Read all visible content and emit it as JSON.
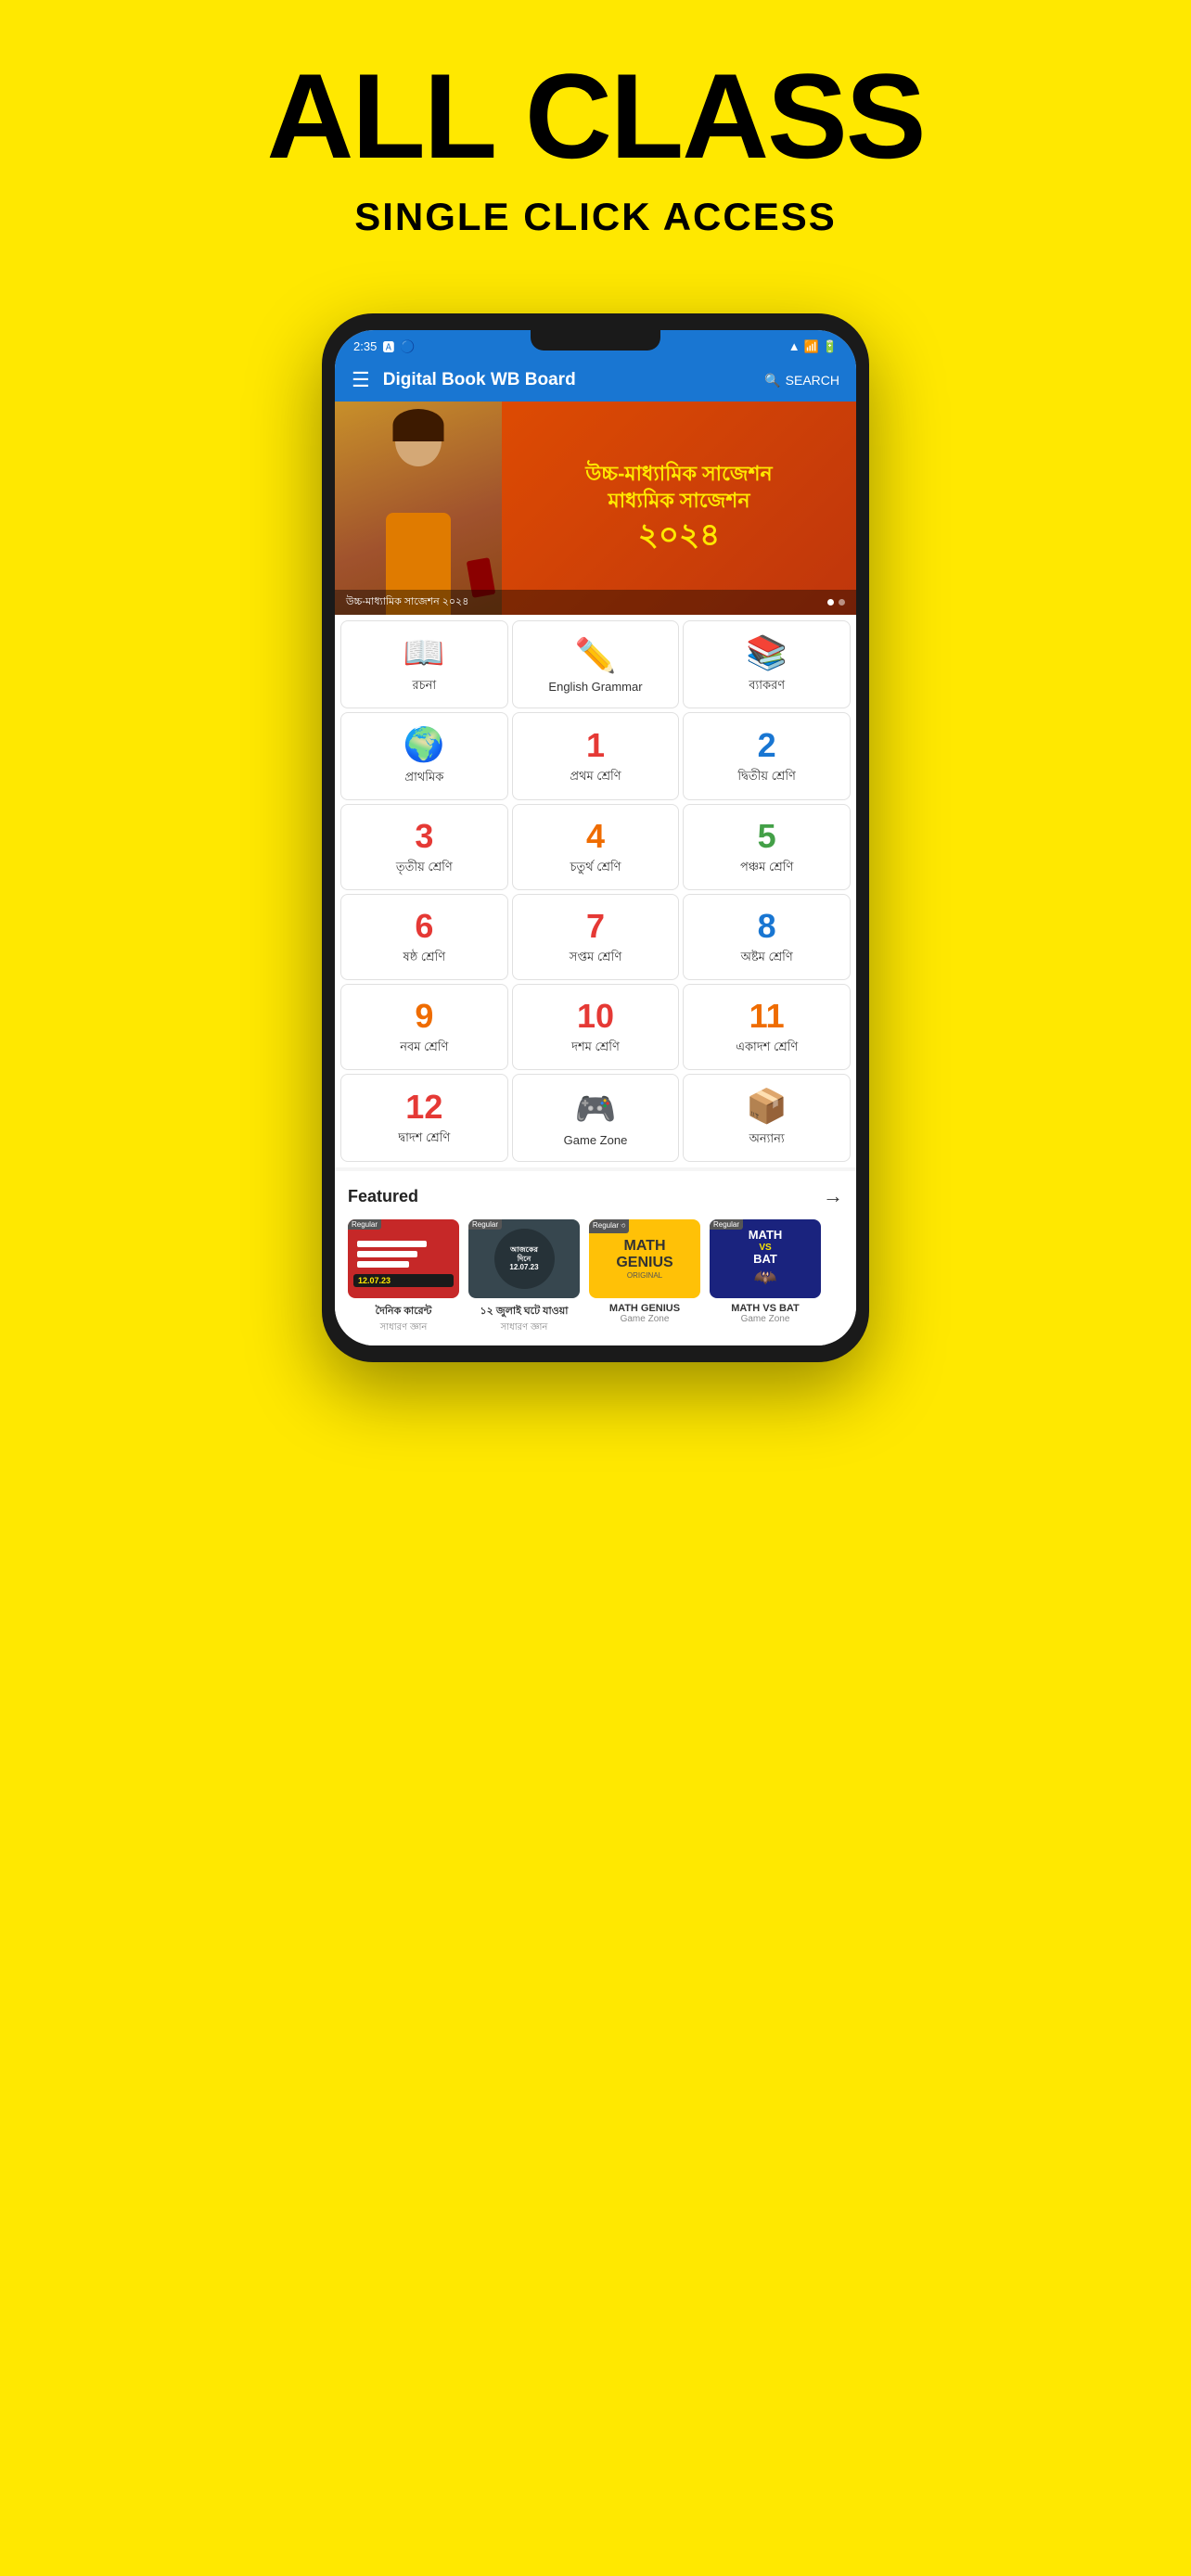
{
  "headline": "ALL CLASS",
  "subheadline": "SINGLE CLICK ACCESS",
  "app": {
    "title": "Digital Book WB Board",
    "search_label": "SEARCH",
    "status_time": "2:35"
  },
  "banner": {
    "text1": "উচ্চ-মাধ্যামিক সাজেশন",
    "text2": "মাধ্যমিক সাজেশন",
    "text3": "২০২৪",
    "caption": "উচ্চ-মাধ্যামিক সাজেশন ২০২৪"
  },
  "grid": {
    "items": [
      {
        "label": "রচনা",
        "icon": "📖",
        "color": "#5c6bc0"
      },
      {
        "label": "English Grammar",
        "icon": "✏️",
        "color": "#7c4dff"
      },
      {
        "label": "ব্যাকরণ",
        "icon": "📚",
        "color": "#ef6c00"
      },
      {
        "label": "প্রাথমিক",
        "icon": "🌍",
        "color": "#4caf50"
      },
      {
        "label": "প্রথম শ্রেণি",
        "icon": "1️⃣",
        "color": "#e53935"
      },
      {
        "label": "দ্বিতীয় শ্রেণি",
        "icon": "2️⃣",
        "color": "#1976d2"
      },
      {
        "label": "তৃতীয় শ্রেণি",
        "icon": "3️⃣",
        "color": "#e53935"
      },
      {
        "label": "চতুর্থ শ্রেণি",
        "icon": "4️⃣",
        "color": "#ef6c00"
      },
      {
        "label": "পঞ্চম শ্রেণি",
        "icon": "5️⃣",
        "color": "#43a047"
      },
      {
        "label": "ষষ্ঠ শ্রেণি",
        "icon": "6️⃣",
        "color": "#e53935"
      },
      {
        "label": "সপ্তম শ্রেণি",
        "icon": "7️⃣",
        "color": "#e53935"
      },
      {
        "label": "অষ্টম শ্রেণি",
        "icon": "8️⃣",
        "color": "#1976d2"
      },
      {
        "label": "নবম শ্রেণি",
        "icon": "9️⃣",
        "color": "#ef6c00"
      },
      {
        "label": "দশম শ্রেণি",
        "icon": "🔟",
        "color": "#e53935"
      },
      {
        "label": "একাদশ শ্রেণি",
        "icon": "11",
        "color": "#ef6c00"
      },
      {
        "label": "দ্বাদশ শ্রেণি",
        "icon": "12",
        "color": "#e53935"
      },
      {
        "label": "Game Zone",
        "icon": "🎮",
        "color": "#4caf50"
      },
      {
        "label": "অন্যান্য",
        "icon": "📦",
        "color": "#ef6c00"
      }
    ]
  },
  "featured": {
    "title": "Featured",
    "arrow": "→",
    "cards": [
      {
        "title": "দৈনিক কারেন্ট",
        "subtitle": "সাধারণ জ্ঞান",
        "type": "Regular",
        "date": "12.07.23"
      },
      {
        "title": "১২ জুলাই ঘটে যাওয়া",
        "subtitle": "সাধারণ জ্ঞান",
        "type": "Regular",
        "date": "12.07.23"
      },
      {
        "title": "MATH GENIUS",
        "subtitle": "Game Zone",
        "type": "Regular"
      },
      {
        "title": "MATH VS BAT",
        "subtitle": "Game Zone",
        "type": "Regular"
      }
    ]
  }
}
